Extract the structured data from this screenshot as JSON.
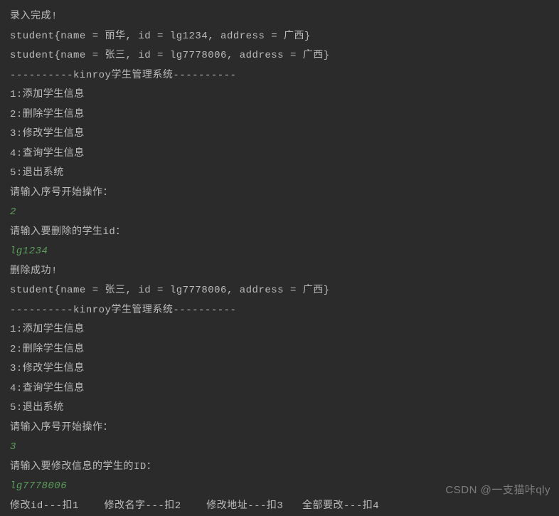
{
  "lines": [
    {
      "text": "录入完成!",
      "type": "out"
    },
    {
      "text": "student{name = 丽华, id = lg1234, address = 广西}",
      "type": "out"
    },
    {
      "text": "student{name = 张三, id = lg7778006, address = 广西}",
      "type": "out"
    },
    {
      "text": "----------kinroy学生管理系统----------",
      "type": "out"
    },
    {
      "text": "1:添加学生信息",
      "type": "out"
    },
    {
      "text": "2:删除学生信息",
      "type": "out"
    },
    {
      "text": "3:修改学生信息",
      "type": "out"
    },
    {
      "text": "4:查询学生信息",
      "type": "out"
    },
    {
      "text": "5:退出系统",
      "type": "out"
    },
    {
      "text": "请输入序号开始操作：",
      "type": "out"
    },
    {
      "text": "2",
      "type": "in"
    },
    {
      "text": "请输入要删除的学生id：",
      "type": "out"
    },
    {
      "text": "lg1234",
      "type": "in"
    },
    {
      "text": "删除成功!",
      "type": "out"
    },
    {
      "text": "student{name = 张三, id = lg7778006, address = 广西}",
      "type": "out"
    },
    {
      "text": "----------kinroy学生管理系统----------",
      "type": "out"
    },
    {
      "text": "1:添加学生信息",
      "type": "out"
    },
    {
      "text": "2:删除学生信息",
      "type": "out"
    },
    {
      "text": "3:修改学生信息",
      "type": "out"
    },
    {
      "text": "4:查询学生信息",
      "type": "out"
    },
    {
      "text": "5:退出系统",
      "type": "out"
    },
    {
      "text": "请输入序号开始操作：",
      "type": "out"
    },
    {
      "text": "3",
      "type": "in"
    },
    {
      "text": "请输入要修改信息的学生的ID：",
      "type": "out"
    },
    {
      "text": "lg7778006",
      "type": "in"
    },
    {
      "text": "修改id---扣1    修改名字---扣2    修改地址---扣3   全部要改---扣4",
      "type": "out"
    }
  ],
  "watermark": "CSDN @一支猫咔qly"
}
